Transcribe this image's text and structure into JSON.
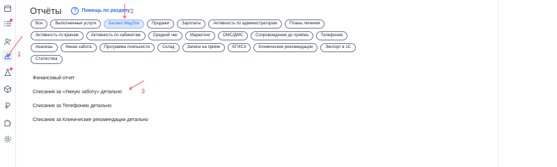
{
  "page": {
    "title": "Отчёты",
    "help_label": "Помощь по разделу"
  },
  "sidebar": {
    "icons": [
      "calendar-icon",
      "checklist-icon",
      "users-icon",
      "chart-icon",
      "flask-icon",
      "box-icon",
      "ruble-icon",
      "puzzle-icon",
      "gear-icon"
    ],
    "active": "chart-icon"
  },
  "report_tabs": {
    "rows": [
      [
        "Все",
        "Выполненные услуги",
        "Баланс МедЛок",
        "Продажи",
        "Зарплаты",
        "Активность по администраторам",
        "Планы лечения"
      ],
      [
        "Активность по врачам",
        "Активность по кабинетам",
        "Средний чек",
        "Маркетинг",
        "ОМС/ДМС",
        "Сопровождение до приёма",
        "Телефония"
      ],
      [
        "Анализы",
        "Умная забота",
        "Программа лояльности",
        "Склад",
        "Записи на приём",
        "ЕГИСЗ",
        "Клинические рекомендации",
        "Экспорт в 1С"
      ],
      [
        "Статистика"
      ]
    ],
    "active": "Баланс МедЛок"
  },
  "reports": [
    "Финансовый отчет",
    "Списания за «Умную заботу» детально",
    "Списания за Телефонию детально",
    "Списания за Клинические рекомендации детально"
  ],
  "annotations": [
    "1",
    "2",
    "3"
  ],
  "colors": {
    "accent": "#2f6bff",
    "active_chip_bg": "#dde8ff",
    "annotation": "#e53935"
  }
}
